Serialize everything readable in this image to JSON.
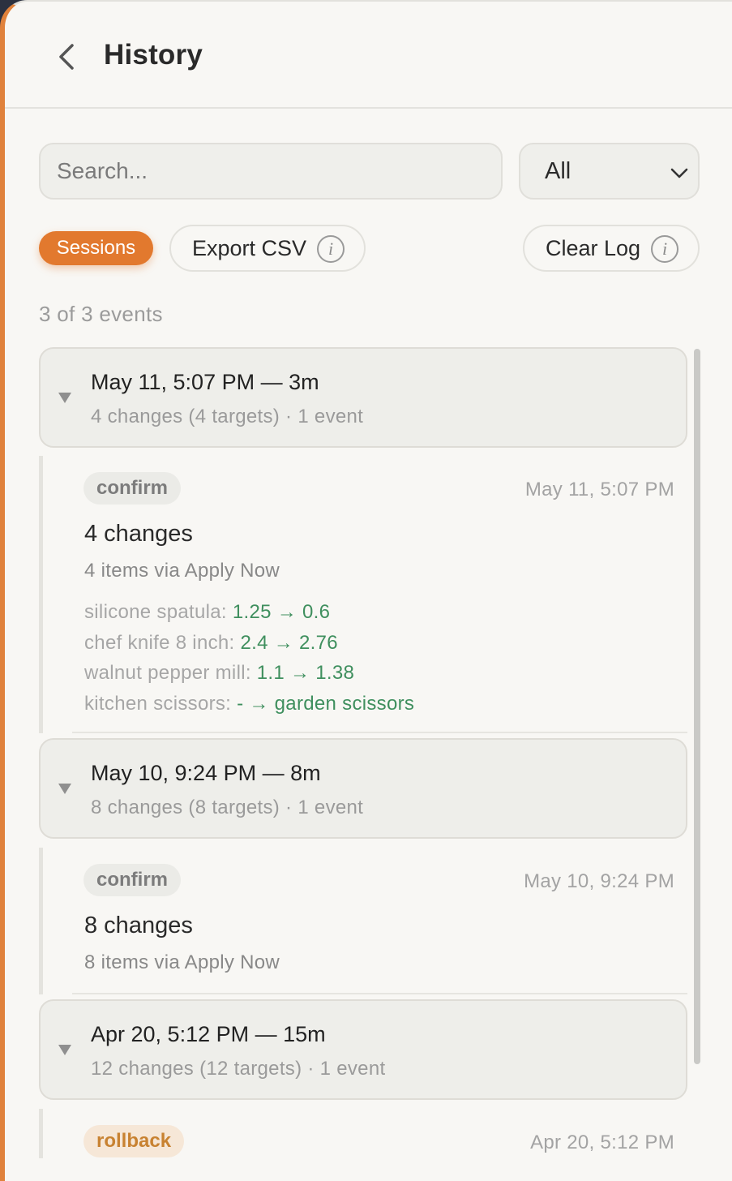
{
  "header": {
    "title": "History"
  },
  "search": {
    "placeholder": "Search...",
    "value": ""
  },
  "filter": {
    "selected": "All"
  },
  "actions": {
    "sessions_label": "Sessions",
    "export_label": "Export CSV",
    "clear_label": "Clear Log"
  },
  "summary": {
    "count_text": "3 of 3 events"
  },
  "sessions": [
    {
      "title": "May 11, 5:07 PM — 3m",
      "meta": "4 changes (4 targets) · 1 event",
      "event": {
        "type": "confirm",
        "time": "May 11, 5:07 PM",
        "title": "4 changes",
        "subtitle": "4 items via Apply Now",
        "changes": [
          {
            "label": "silicone spatula:",
            "value": "1.25 → 0.6"
          },
          {
            "label": "chef knife 8 inch:",
            "value": "2.4 → 2.76"
          },
          {
            "label": "walnut pepper mill:",
            "value": "1.1 → 1.38"
          },
          {
            "label": "kitchen scissors:",
            "value": "- → garden scissors"
          }
        ]
      }
    },
    {
      "title": "May 10, 9:24 PM — 8m",
      "meta": "8 changes (8 targets) · 1 event",
      "event": {
        "type": "confirm",
        "time": "May 10, 9:24 PM",
        "title": "8 changes",
        "subtitle": "8 items via Apply Now",
        "changes": []
      }
    },
    {
      "title": "Apr 20, 5:12 PM — 15m",
      "meta": "12 changes (12 targets) · 1 event",
      "event": {
        "type": "rollback",
        "time": "Apr 20, 5:12 PM"
      }
    }
  ],
  "colors": {
    "accent": "#e2792e",
    "change_value": "#3f8f5e",
    "rollback_tag": "#c88231"
  },
  "icons": {
    "back": "chevron-left-icon",
    "select": "chevron-down-icon",
    "info": "info-icon",
    "collapse": "caret-down-icon"
  }
}
